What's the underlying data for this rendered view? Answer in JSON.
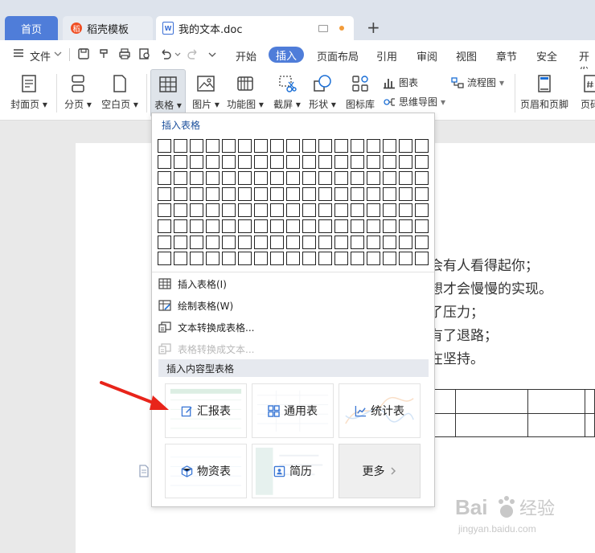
{
  "tabs": {
    "home": "首页",
    "template": "稻壳模板",
    "document": "我的文本.doc"
  },
  "menu": {
    "file": "文件",
    "items": [
      "开始",
      "插入",
      "页面布局",
      "引用",
      "审阅",
      "视图",
      "章节",
      "安全",
      "开发"
    ],
    "active": "插入"
  },
  "ribbon": {
    "cover": "封面页",
    "page_break": "分页",
    "blank_page": "空白页",
    "table": "表格",
    "picture": "图片",
    "function_chart": "功能图",
    "screenshot": "截屏",
    "shape": "形状",
    "icon_library": "图标库",
    "chart": "图表",
    "flowchart": "流程图",
    "mindmap": "思维导图",
    "header_footer": "页眉和页脚",
    "page_number": "页码"
  },
  "document": {
    "lines": [
      "会有人看得起你；",
      "想才会慢慢的实现。",
      "了压力；",
      "有了退路；",
      "在坚持。"
    ]
  },
  "dropdown": {
    "title": "插入表格",
    "grid_cols": 17,
    "grid_rows": 8,
    "items": [
      {
        "label": "插入表格(I)",
        "icon": "insert-table-icon",
        "enabled": true
      },
      {
        "label": "绘制表格(W)",
        "icon": "draw-table-icon",
        "enabled": true
      },
      {
        "label": "文本转换成表格...",
        "icon": "text-to-table-icon",
        "enabled": true
      },
      {
        "label": "表格转换成文本...",
        "icon": "table-to-text-icon",
        "enabled": false
      }
    ],
    "section_title": "插入内容型表格",
    "cards": [
      {
        "label": "汇报表",
        "icon": "edit-icon"
      },
      {
        "label": "通用表",
        "icon": "grid-icon"
      },
      {
        "label": "统计表",
        "icon": "line-chart-icon"
      },
      {
        "label": "物资表",
        "icon": "cube-icon"
      },
      {
        "label": "简历",
        "icon": "resume-icon"
      },
      {
        "label": "更多",
        "icon": "chevron-right-icon"
      }
    ]
  },
  "watermark": {
    "brand": "Bai经验",
    "url": "jingyan.baidu.com"
  },
  "colors": {
    "accent": "#4f7dd9",
    "card_icon": "#3b78d6"
  }
}
